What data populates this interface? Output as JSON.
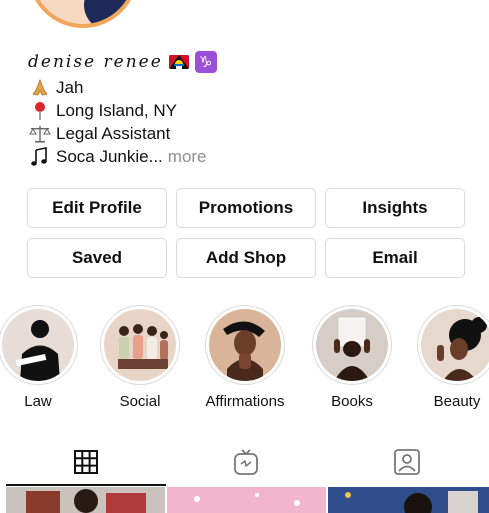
{
  "profile": {
    "name": "denise renee",
    "flag_icon": "antigua-flag-icon",
    "zodiac_icon": "capricorn-icon",
    "zodiac_glyph": "♑",
    "bio": [
      {
        "icon": "praying-hands-icon",
        "glyph": "🙏",
        "text": "Jah"
      },
      {
        "icon": "map-pin-icon",
        "glyph": "📍",
        "text": "Long Island, NY"
      },
      {
        "icon": "scales-icon",
        "glyph": "⚖",
        "text": "Legal Assistant"
      },
      {
        "icon": "music-notes-icon",
        "glyph": "🎶",
        "text": "Soca Junkie..."
      }
    ],
    "more_label": "more"
  },
  "buttons": {
    "edit_profile": "Edit Profile",
    "promotions": "Promotions",
    "insights": "Insights",
    "saved": "Saved",
    "add_shop": "Add Shop",
    "email": "Email"
  },
  "highlights": [
    {
      "label": "Law"
    },
    {
      "label": "Social"
    },
    {
      "label": "Affirmations"
    },
    {
      "label": "Books"
    },
    {
      "label": "Beauty"
    }
  ],
  "tabs": [
    {
      "icon": "grid-icon"
    },
    {
      "icon": "igtv-icon"
    },
    {
      "icon": "tagged-icon"
    }
  ],
  "colors": {
    "border": "#dbdbdb",
    "muted_text": "#8e8e8e",
    "zodiac_bg": "#9b4fd6",
    "avatar_ring": "#f2a65a"
  }
}
